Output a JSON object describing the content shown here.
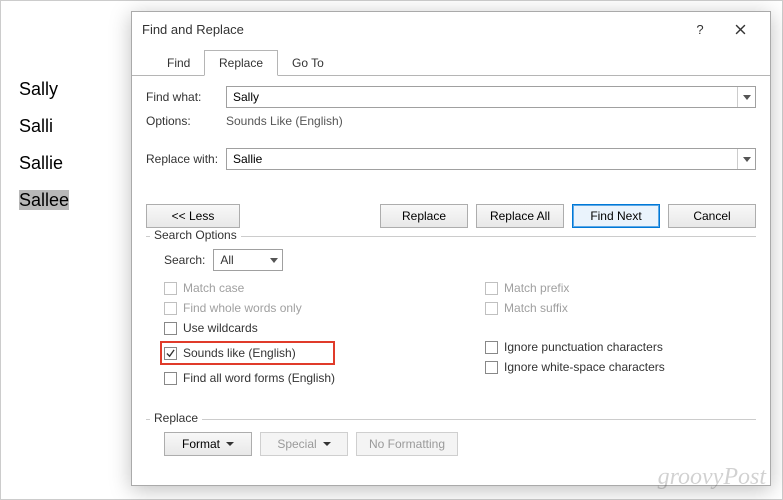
{
  "document": {
    "lines": [
      "Sally",
      "Salli",
      "Sallie",
      "Sallee"
    ],
    "highlighted_index": 3
  },
  "dialog": {
    "title": "Find and Replace",
    "help_label": "?",
    "tabs": {
      "find": "Find",
      "replace": "Replace",
      "goto": "Go To",
      "active": "replace"
    },
    "find_what_label": "Find what:",
    "find_what_value": "Sally",
    "options_label": "Options:",
    "options_value": "Sounds Like (English)",
    "replace_with_label": "Replace with:",
    "replace_with_value": "Sallie",
    "buttons": {
      "less": "<< Less",
      "replace": "Replace",
      "replace_all": "Replace All",
      "find_next": "Find Next",
      "cancel": "Cancel"
    },
    "search_options_title": "Search Options",
    "search_label": "Search:",
    "search_value": "All",
    "checks": {
      "match_case": "Match case",
      "whole_words": "Find whole words only",
      "wildcards": "Use wildcards",
      "sounds_like": "Sounds like (English)",
      "word_forms": "Find all word forms (English)",
      "match_prefix": "Match prefix",
      "match_suffix": "Match suffix",
      "ignore_punct": "Ignore punctuation characters",
      "ignore_ws": "Ignore white-space characters"
    },
    "replace_section_title": "Replace",
    "bottom": {
      "format": "Format",
      "special": "Special",
      "no_formatting": "No Formatting"
    }
  },
  "watermark": "groovyPost"
}
